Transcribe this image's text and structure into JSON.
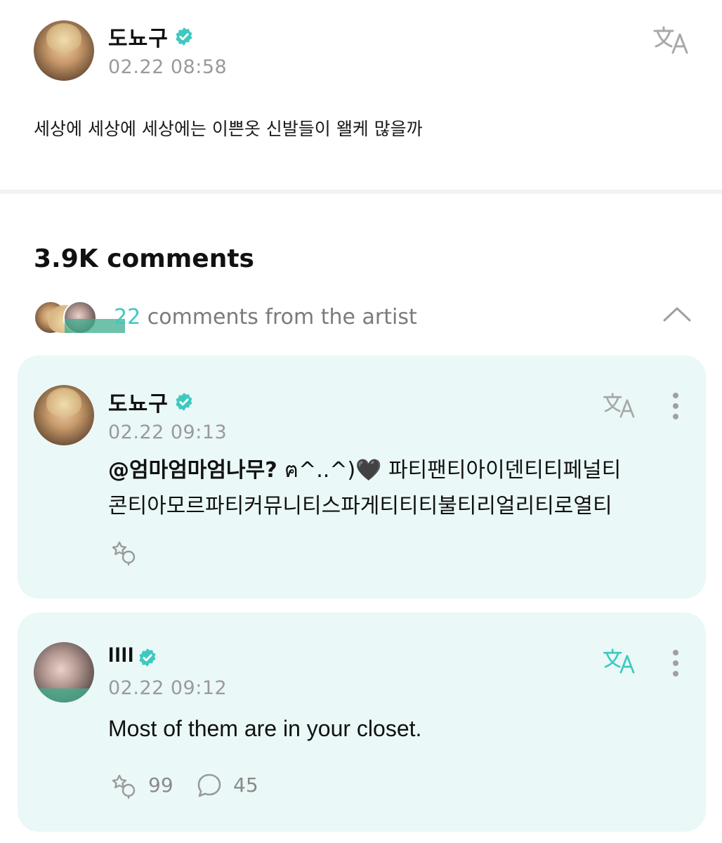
{
  "post": {
    "author": "도뇨구",
    "timestamp": "02.22 08:58",
    "text": "세상에 세상에 세상에는 이쁜옷 신발들이 왤케 많을까"
  },
  "comments_header": {
    "count_label": "3.9K comments",
    "artist_count": "22",
    "artist_label": " comments from the artist"
  },
  "comments": [
    {
      "author": "도뇨구",
      "timestamp": "02.22 09:13",
      "mention": "@엄마엄마엄나무? ",
      "emoticon": "ฅ^..^)🖤",
      "text_line1": " 파티팬티아이덴티티페널티",
      "text_line2": "콘티아모르파티커뮤니티스파게티티티불티리얼리티로열티"
    },
    {
      "author": "IIII",
      "timestamp": "02.22 09:12",
      "text": "Most of them are in your closet.",
      "likes": "99",
      "replies": "45"
    }
  ],
  "colors": {
    "accent": "#3ec9c0",
    "card_bg": "#eaf8f7",
    "muted": "#9a9a9a"
  },
  "icons": [
    "verified-badge-icon",
    "translate-icon",
    "more-dots-icon",
    "chevron-up-icon",
    "like-sparkle-icon",
    "reply-bubble-icon"
  ]
}
